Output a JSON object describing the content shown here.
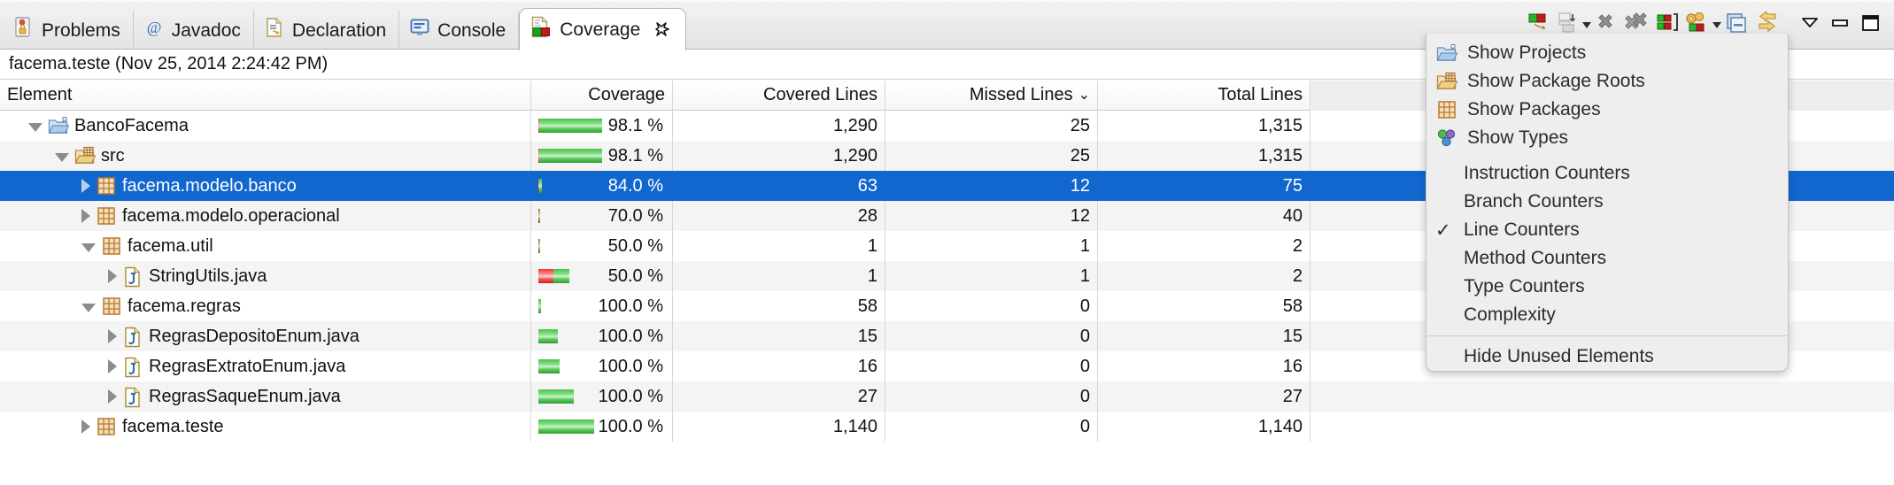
{
  "tabs": [
    {
      "label": "Problems",
      "icon": "problems-icon",
      "active": false
    },
    {
      "label": "Javadoc",
      "icon": "javadoc-icon",
      "active": false
    },
    {
      "label": "Declaration",
      "icon": "declaration-icon",
      "active": false
    },
    {
      "label": "Console",
      "icon": "console-icon",
      "active": false
    },
    {
      "label": "Coverage",
      "icon": "coverage-icon",
      "active": true
    }
  ],
  "toolbar": {
    "buttons": [
      {
        "name": "coverage-session-icon",
        "has_arrow": false
      },
      {
        "name": "export-session-icon",
        "has_arrow": true
      },
      {
        "name": "remove-session-icon",
        "has_arrow": false
      },
      {
        "name": "remove-all-sessions-icon",
        "has_arrow": false
      },
      {
        "name": "select-session-icon",
        "has_arrow": false
      },
      {
        "name": "coverage-settings-icon",
        "has_arrow": true
      },
      {
        "name": "collapse-all-icon",
        "has_arrow": false
      },
      {
        "name": "link-with-selection-icon",
        "has_arrow": false
      },
      {
        "name": "view-menu-icon",
        "has_arrow": false
      },
      {
        "name": "minimize-icon",
        "has_arrow": false
      },
      {
        "name": "maximize-icon",
        "has_arrow": false
      }
    ]
  },
  "session": {
    "label": "facema.teste (Nov 25, 2014 2:24:42 PM)"
  },
  "table": {
    "columns": [
      {
        "key": "element",
        "label": "Element"
      },
      {
        "key": "coverage",
        "label": "Coverage"
      },
      {
        "key": "covered",
        "label": "Covered Lines"
      },
      {
        "key": "missed",
        "label": "Missed Lines",
        "sorted": true,
        "sort_dir": "desc",
        "sort_glyph": "⌄"
      },
      {
        "key": "total",
        "label": "Total Lines"
      }
    ],
    "rows": [
      {
        "label": "BancoFacema",
        "depth": 0,
        "icon": "project-folder-icon",
        "twisty": "down",
        "selected": false,
        "coverage": "98.1 %",
        "covered": "1,290",
        "missed": "25",
        "total": "1,315",
        "bar_width_pct": 100,
        "bar_green_pct": 98.1
      },
      {
        "label": "src",
        "depth": 1,
        "icon": "source-folder-icon",
        "twisty": "down",
        "selected": false,
        "coverage": "98.1 %",
        "covered": "1,290",
        "missed": "25",
        "total": "1,315",
        "bar_width_pct": 100,
        "bar_green_pct": 98.1
      },
      {
        "label": "facema.modelo.banco",
        "depth": 2,
        "icon": "package-icon",
        "twisty": "right",
        "selected": true,
        "coverage": "84.0 %",
        "covered": "63",
        "missed": "12",
        "total": "75",
        "bar_width_pct": 6,
        "bar_green_pct": 84.0
      },
      {
        "label": "facema.modelo.operacional",
        "depth": 2,
        "icon": "package-icon",
        "twisty": "right",
        "selected": false,
        "coverage": "70.0 %",
        "covered": "28",
        "missed": "12",
        "total": "40",
        "bar_width_pct": 3,
        "bar_green_pct": 70.0
      },
      {
        "label": "facema.util",
        "depth": 2,
        "icon": "package-icon",
        "twisty": "down",
        "selected": false,
        "coverage": "50.0 %",
        "covered": "1",
        "missed": "1",
        "total": "2",
        "bar_width_pct": 1,
        "bar_green_pct": 50.0
      },
      {
        "label": "StringUtils.java",
        "depth": 3,
        "icon": "java-file-icon",
        "twisty": "right",
        "selected": false,
        "coverage": "50.0 %",
        "covered": "1",
        "missed": "1",
        "total": "2",
        "bar_width_pct": 48,
        "bar_green_pct": 50.0
      },
      {
        "label": "facema.regras",
        "depth": 2,
        "icon": "package-icon",
        "twisty": "down",
        "selected": false,
        "coverage": "100.0 %",
        "covered": "58",
        "missed": "0",
        "total": "58",
        "bar_width_pct": 4,
        "bar_green_pct": 100
      },
      {
        "label": "RegrasDepositoEnum.java",
        "depth": 3,
        "icon": "java-file-icon",
        "twisty": "right",
        "selected": false,
        "coverage": "100.0 %",
        "covered": "15",
        "missed": "0",
        "total": "15",
        "bar_width_pct": 31,
        "bar_green_pct": 100
      },
      {
        "label": "RegrasExtratoEnum.java",
        "depth": 3,
        "icon": "java-file-icon",
        "twisty": "right",
        "selected": false,
        "coverage": "100.0 %",
        "covered": "16",
        "missed": "0",
        "total": "16",
        "bar_width_pct": 33,
        "bar_green_pct": 100
      },
      {
        "label": "RegrasSaqueEnum.java",
        "depth": 3,
        "icon": "java-file-icon",
        "twisty": "right",
        "selected": false,
        "coverage": "100.0 %",
        "covered": "27",
        "missed": "0",
        "total": "27",
        "bar_width_pct": 56,
        "bar_green_pct": 100
      },
      {
        "label": "facema.teste",
        "depth": 2,
        "icon": "package-icon",
        "twisty": "right",
        "selected": false,
        "coverage": "100.0 %",
        "covered": "1,140",
        "missed": "0",
        "total": "1,140",
        "bar_width_pct": 88,
        "bar_green_pct": 100
      }
    ]
  },
  "menu": {
    "groups": [
      {
        "items": [
          {
            "label": "Show Projects",
            "icon": "project-folder-icon",
            "checked": false
          },
          {
            "label": "Show Package Roots",
            "icon": "source-folder-icon",
            "checked": false
          },
          {
            "label": "Show Packages",
            "icon": "package-icon",
            "checked": false
          },
          {
            "label": "Show Types",
            "icon": "types-icon",
            "checked": false
          }
        ]
      },
      {
        "items": [
          {
            "label": "Instruction Counters",
            "icon": null,
            "checked": false
          },
          {
            "label": "Branch Counters",
            "icon": null,
            "checked": false
          },
          {
            "label": "Line Counters",
            "icon": null,
            "checked": true
          },
          {
            "label": "Method Counters",
            "icon": null,
            "checked": false
          },
          {
            "label": "Type Counters",
            "icon": null,
            "checked": false
          },
          {
            "label": "Complexity",
            "icon": null,
            "checked": false
          }
        ]
      },
      {
        "items": [
          {
            "label": "Hide Unused Elements",
            "icon": null,
            "checked": false
          }
        ]
      }
    ],
    "check_glyph": "✓"
  },
  "colors": {
    "selection_blue": "#1267cf",
    "covered_green": "#4cbf4c",
    "missed_red": "#e8393c",
    "menu_bg": "#eeeeee"
  }
}
